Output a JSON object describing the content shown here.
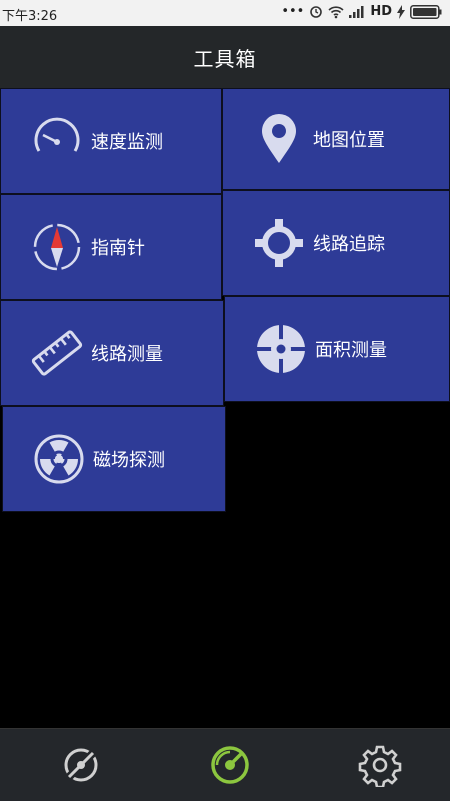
{
  "status_bar": {
    "time": "下午3:26",
    "dots": "•••",
    "network": "HD"
  },
  "header": {
    "title": "工具箱"
  },
  "tools": [
    {
      "label": "速度监测",
      "icon": "speedometer-icon"
    },
    {
      "label": "地图位置",
      "icon": "map-pin-icon"
    },
    {
      "label": "指南针",
      "icon": "compass-icon"
    },
    {
      "label": "线路追踪",
      "icon": "crosshair-icon"
    },
    {
      "label": "线路测量",
      "icon": "ruler-icon"
    },
    {
      "label": "面积测量",
      "icon": "target-icon"
    },
    {
      "label": "磁场探测",
      "icon": "radiation-icon"
    }
  ],
  "bottom_nav": [
    {
      "name": "satellite-icon",
      "active": false
    },
    {
      "name": "radar-icon",
      "active": true
    },
    {
      "name": "gear-icon",
      "active": false
    }
  ],
  "colors": {
    "tile": "#2e3b97",
    "icon": "#d8dbee",
    "active_nav": "#8cc63f",
    "inactive_nav": "#d0d0d0"
  }
}
